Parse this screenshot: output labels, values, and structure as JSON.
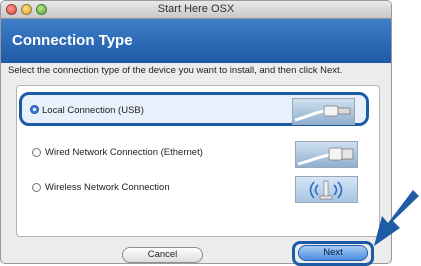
{
  "window": {
    "title": "Start Here OSX"
  },
  "header": {
    "title": "Connection Type"
  },
  "instruction": "Select the connection type of the device you want to install, and then click Next.",
  "options": [
    {
      "label": "Local Connection (USB)",
      "selected": true,
      "image": "usb-cable-icon"
    },
    {
      "label": "Wired Network Connection (Ethernet)",
      "selected": false,
      "image": "ethernet-cable-icon"
    },
    {
      "label": "Wireless Network Connection",
      "selected": false,
      "image": "wireless-antenna-icon"
    }
  ],
  "buttons": {
    "cancel": "Cancel",
    "next": "Next"
  },
  "colors": {
    "header": "#2a6bb8",
    "highlight": "#1b5ba6",
    "arrow": "#1f5ba6"
  }
}
